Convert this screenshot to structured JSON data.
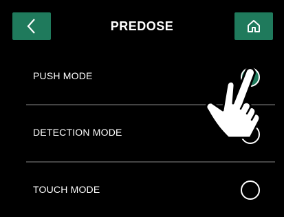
{
  "header": {
    "title": "PREDOSE",
    "back_icon": "chevron-left-icon",
    "home_icon": "home-icon"
  },
  "options": [
    {
      "label": "PUSH MODE",
      "selected": true
    },
    {
      "label": "DETECTION MODE",
      "selected": false
    },
    {
      "label": "TOUCH MODE",
      "selected": false
    }
  ],
  "overlay": {
    "icon": "pointing-hand-icon"
  },
  "colors": {
    "background": "#000000",
    "accent": "#1f7a5c",
    "divider": "#444444",
    "text": "#ffffff"
  }
}
